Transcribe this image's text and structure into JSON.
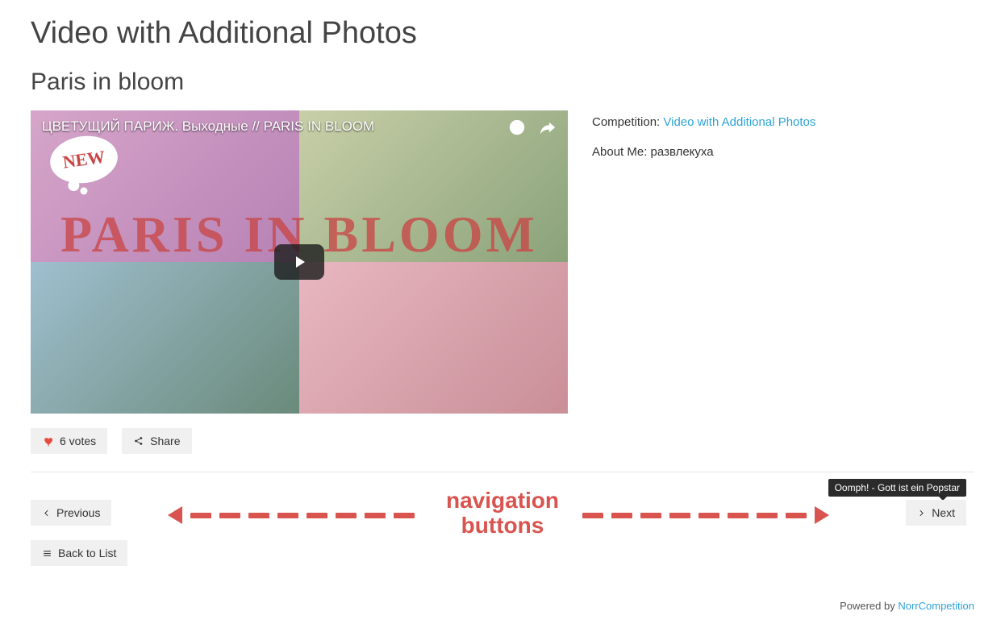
{
  "page_title": "Video with Additional Photos",
  "entry_title": "Paris in bloom",
  "video": {
    "overlay_title": "ЦВЕТУЩИЙ ПАРИЖ. Выходные // PARIS IN BLOOM",
    "overlay_big_text": "PARIS IN BLOOM",
    "new_badge": "NEW"
  },
  "meta": {
    "competition_label": "Competition: ",
    "competition_link": "Video with Additional Photos",
    "about_label": "About Me: ",
    "about_value": "развлекуха"
  },
  "actions": {
    "votes_label": "6 votes",
    "share_label": "Share"
  },
  "nav": {
    "previous": "Previous",
    "next": "Next",
    "back": "Back to List",
    "tooltip_next": "Oomph! - Gott ist ein Popstar"
  },
  "annotation": {
    "line1": "navigation",
    "line2": "buttons"
  },
  "footer": {
    "powered_by": "Powered by ",
    "product": "NorrCompetition"
  }
}
